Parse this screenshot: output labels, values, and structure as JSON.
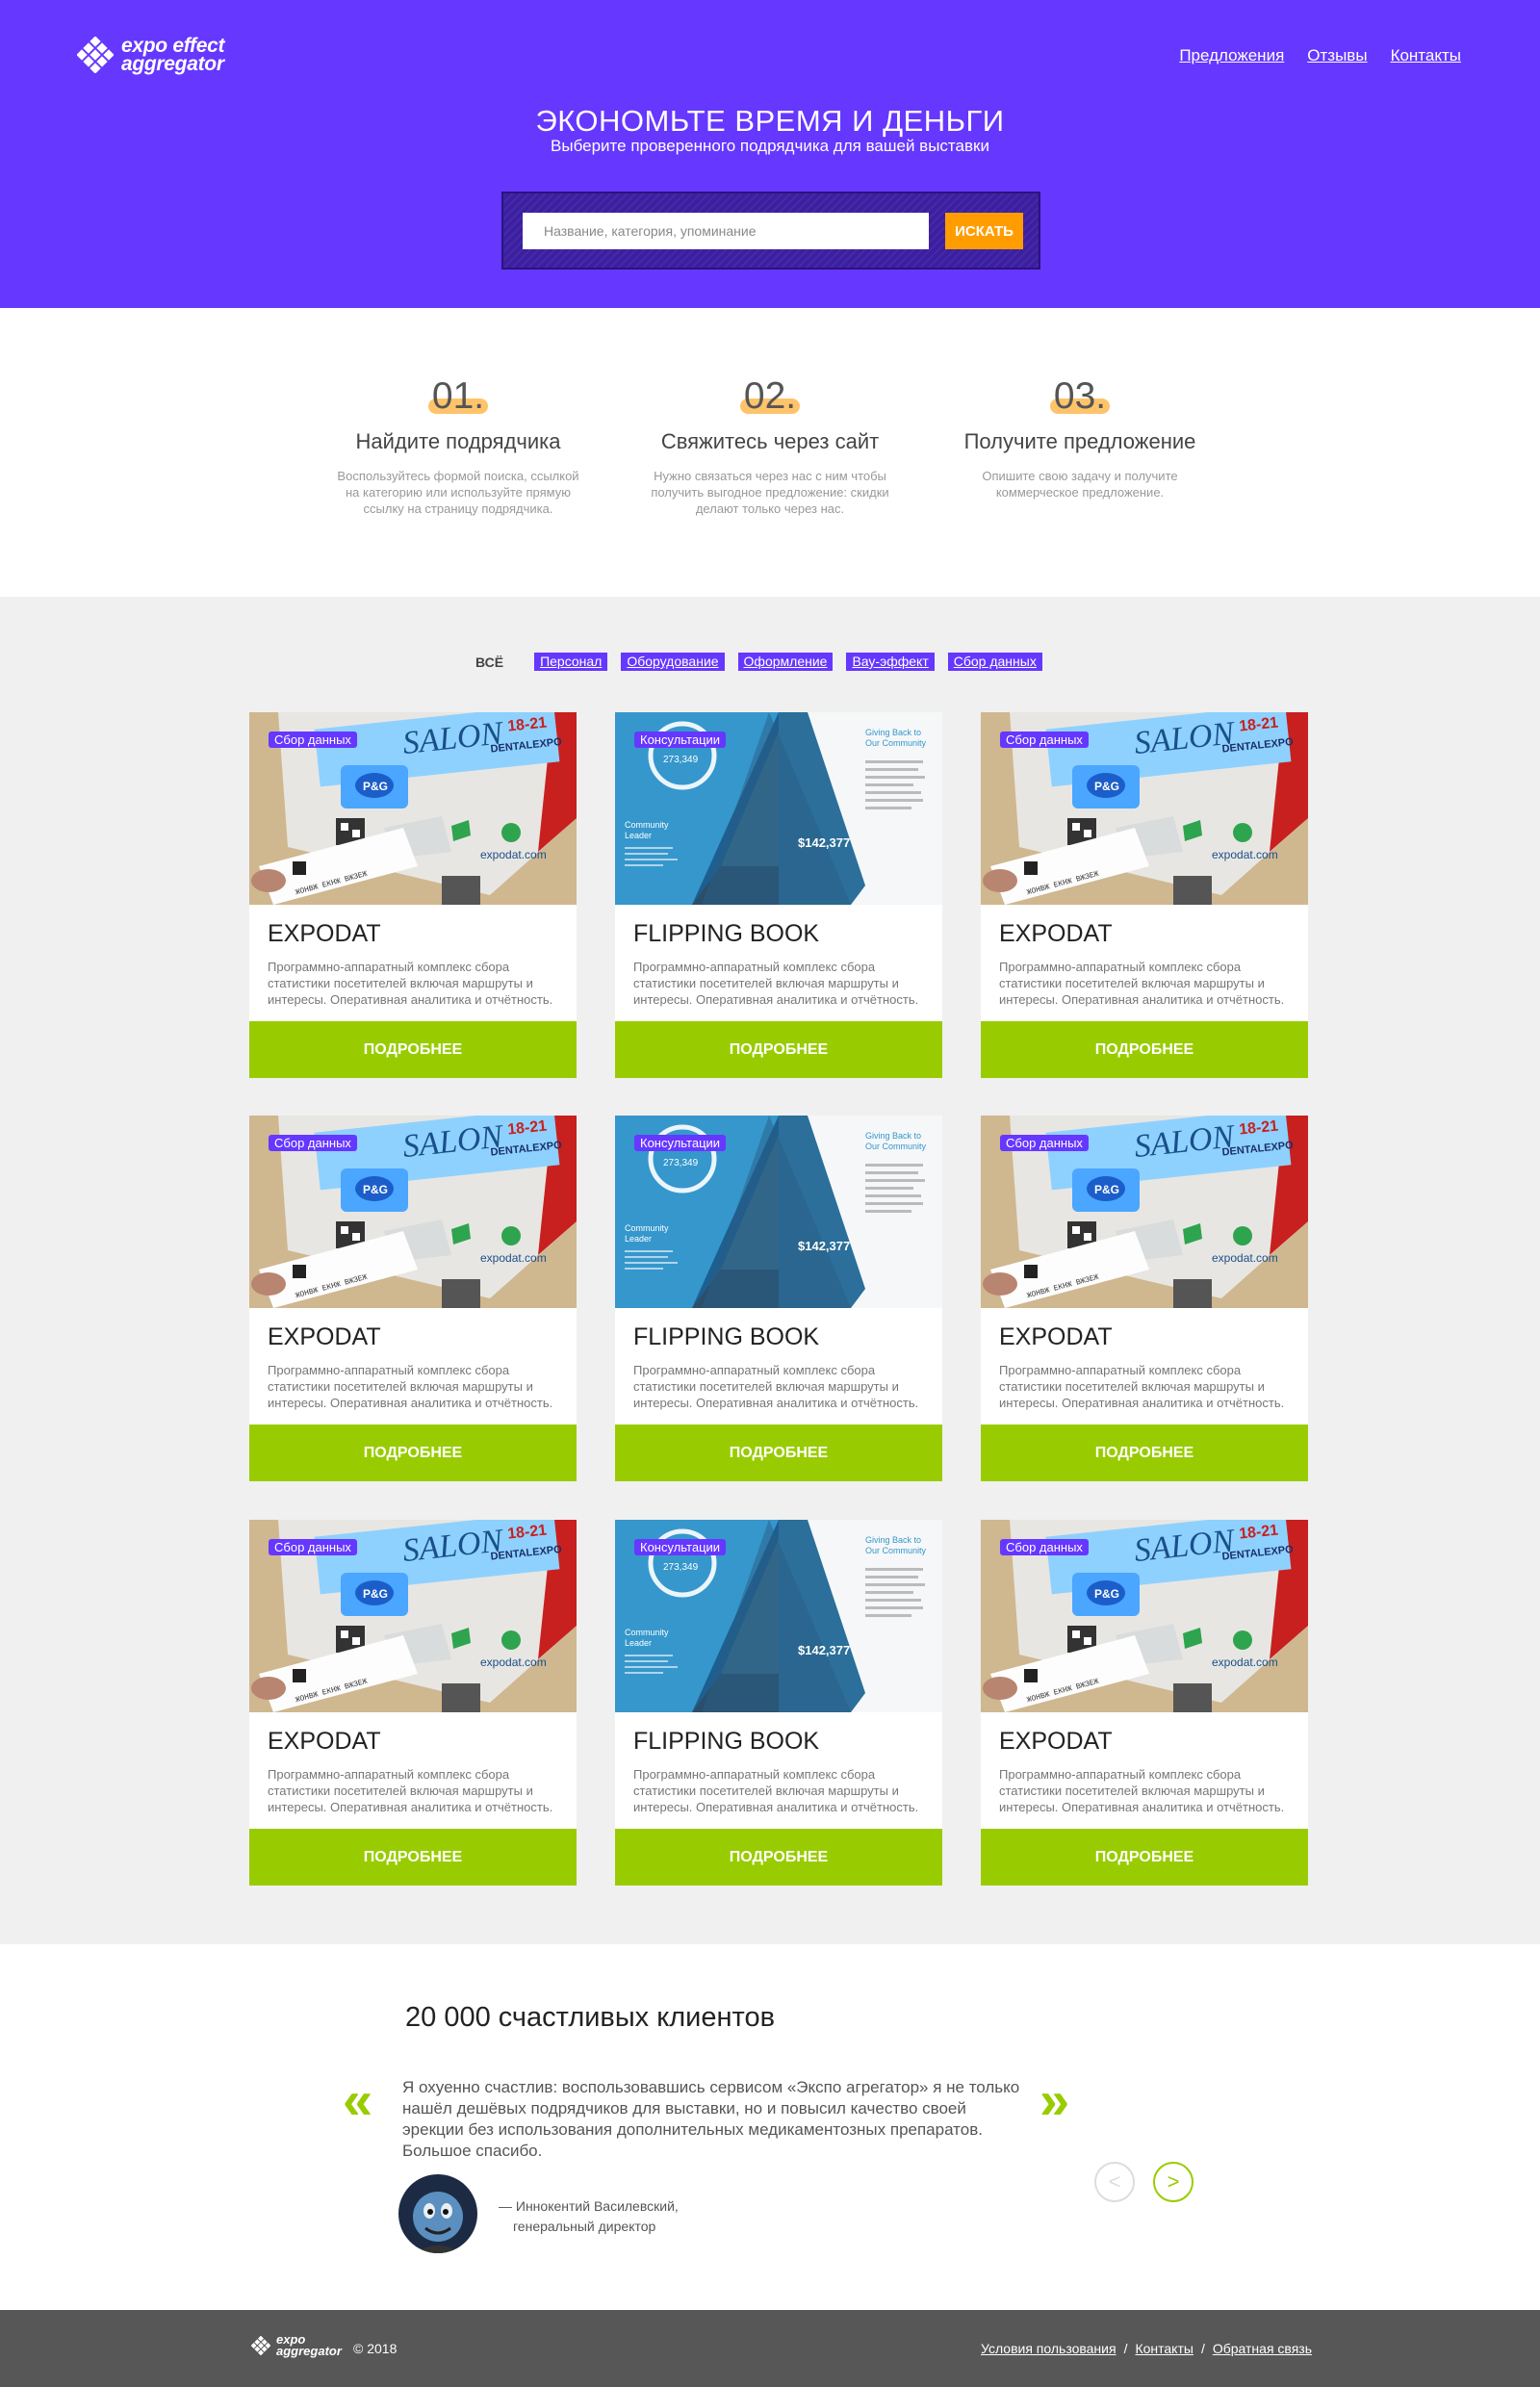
{
  "brand": {
    "logo_line1": "expo effect",
    "logo_line2": "aggregator"
  },
  "nav": {
    "items": [
      "Предложения",
      "Отзывы",
      "Контакты"
    ]
  },
  "hero": {
    "title": "ЭКОНОМЬТЕ ВРЕМЯ И ДЕНЬГИ",
    "subtitle": "Выберите проверенного подрядчика для вашей выставки"
  },
  "search": {
    "placeholder": "Название, категория, упоминание",
    "value": "",
    "button": "ИСКАТЬ"
  },
  "steps": [
    {
      "num": "01.",
      "title": "Найдите подрядчика",
      "desc": "Воспользуйтесь формой поиска, ссылкой на категорию или используйте прямую ссылку на страницу подрядчика."
    },
    {
      "num": "02.",
      "title": "Свяжитесь через сайт",
      "desc": "Нужно связаться через нас с ним чтобы получить выгодное предложение: скидки делают только через нас."
    },
    {
      "num": "03.",
      "title": "Получите предложение",
      "desc": "Опишите свою задачу и получите коммерческое предложение."
    }
  ],
  "filters": {
    "all": "ВСЁ",
    "tags": [
      "Персонал",
      "Оборудование",
      "Оформление",
      "Вау-эффект",
      "Сбор данных"
    ]
  },
  "cards": [
    {
      "badge": "Сбор данных",
      "title": "EXPODAT",
      "desc": "Программно-аппаратный комплекс сбора статистики посетителей включая маршруты и интересы. Оперативная аналитика и отчётность.",
      "button": "ПОДРОБНЕЕ"
    },
    {
      "badge": "Консультации",
      "title": "FLIPPING BOOK",
      "desc": "Программно-аппаратный комплекс сбора статистики посетителей включая маршруты и интересы. Оперативная аналитика и отчётность.",
      "button": "ПОДРОБНЕЕ"
    },
    {
      "badge": "Сбор данных",
      "title": "EXPODAT",
      "desc": "Программно-аппаратный комплекс сбора статистики посетителей включая маршруты и интересы. Оперативная аналитика и отчётность.",
      "button": "ПОДРОБНЕЕ"
    },
    {
      "badge": "Сбор данных",
      "title": "EXPODAT",
      "desc": "Программно-аппаратный комплекс сбора статистики посетителей включая маршруты и интересы. Оперативная аналитика и отчётность.",
      "button": "ПОДРОБНЕЕ"
    },
    {
      "badge": "Консультации",
      "title": "FLIPPING BOOK",
      "desc": "Программно-аппаратный комплекс сбора статистики посетителей включая маршруты и интересы. Оперативная аналитика и отчётность.",
      "button": "ПОДРОБНЕЕ"
    },
    {
      "badge": "Сбор данных",
      "title": "EXPODAT",
      "desc": "Программно-аппаратный комплекс сбора статистики посетителей включая маршруты и интересы. Оперативная аналитика и отчётность.",
      "button": "ПОДРОБНЕЕ"
    },
    {
      "badge": "Сбор данных",
      "title": "EXPODAT",
      "desc": "Программно-аппаратный комплекс сбора статистики посетителей включая маршруты и интересы. Оперативная аналитика и отчётность.",
      "button": "ПОДРОБНЕЕ"
    },
    {
      "badge": "Консультации",
      "title": "FLIPPING BOOK",
      "desc": "Программно-аппаратный комплекс сбора статистики посетителей включая маршруты и интересы. Оперативная аналитика и отчётность.",
      "button": "ПОДРОБНЕЕ"
    },
    {
      "badge": "Сбор данных",
      "title": "EXPODAT",
      "desc": "Программно-аппаратный комплекс сбора статистики посетителей включая маршруты и интересы. Оперативная аналитика и отчётность.",
      "button": "ПОДРОБНЕЕ"
    }
  ],
  "testimonials": {
    "title": "20 000 счастливых клиентов",
    "quote": "Я охуенно счастлив: воспользовавшись сервисом «Экспо агрегатор» я не только нашёл дешёвых подрядчиков для выставки, но и повысил качество своей эрекции без использования дополнительных медикаментозных препаратов. Большое спасибо.",
    "author": "— Иннокентий Василевский,",
    "role": "генеральный директор",
    "quote_open": "«",
    "quote_close": "»",
    "prev": "<",
    "next": ">"
  },
  "footer": {
    "logo_line1": "expo",
    "logo_line2": "aggregator",
    "copyright": "© 2018",
    "links": [
      "Условия пользования",
      "Контакты",
      "Обратная связь"
    ],
    "separator": "/"
  },
  "colors": {
    "brand_purple": "#6637ff",
    "accent_orange": "#ff9d00",
    "accent_green": "#99cc00",
    "footer_gray": "#575757",
    "section_gray": "#f0f0f0"
  }
}
